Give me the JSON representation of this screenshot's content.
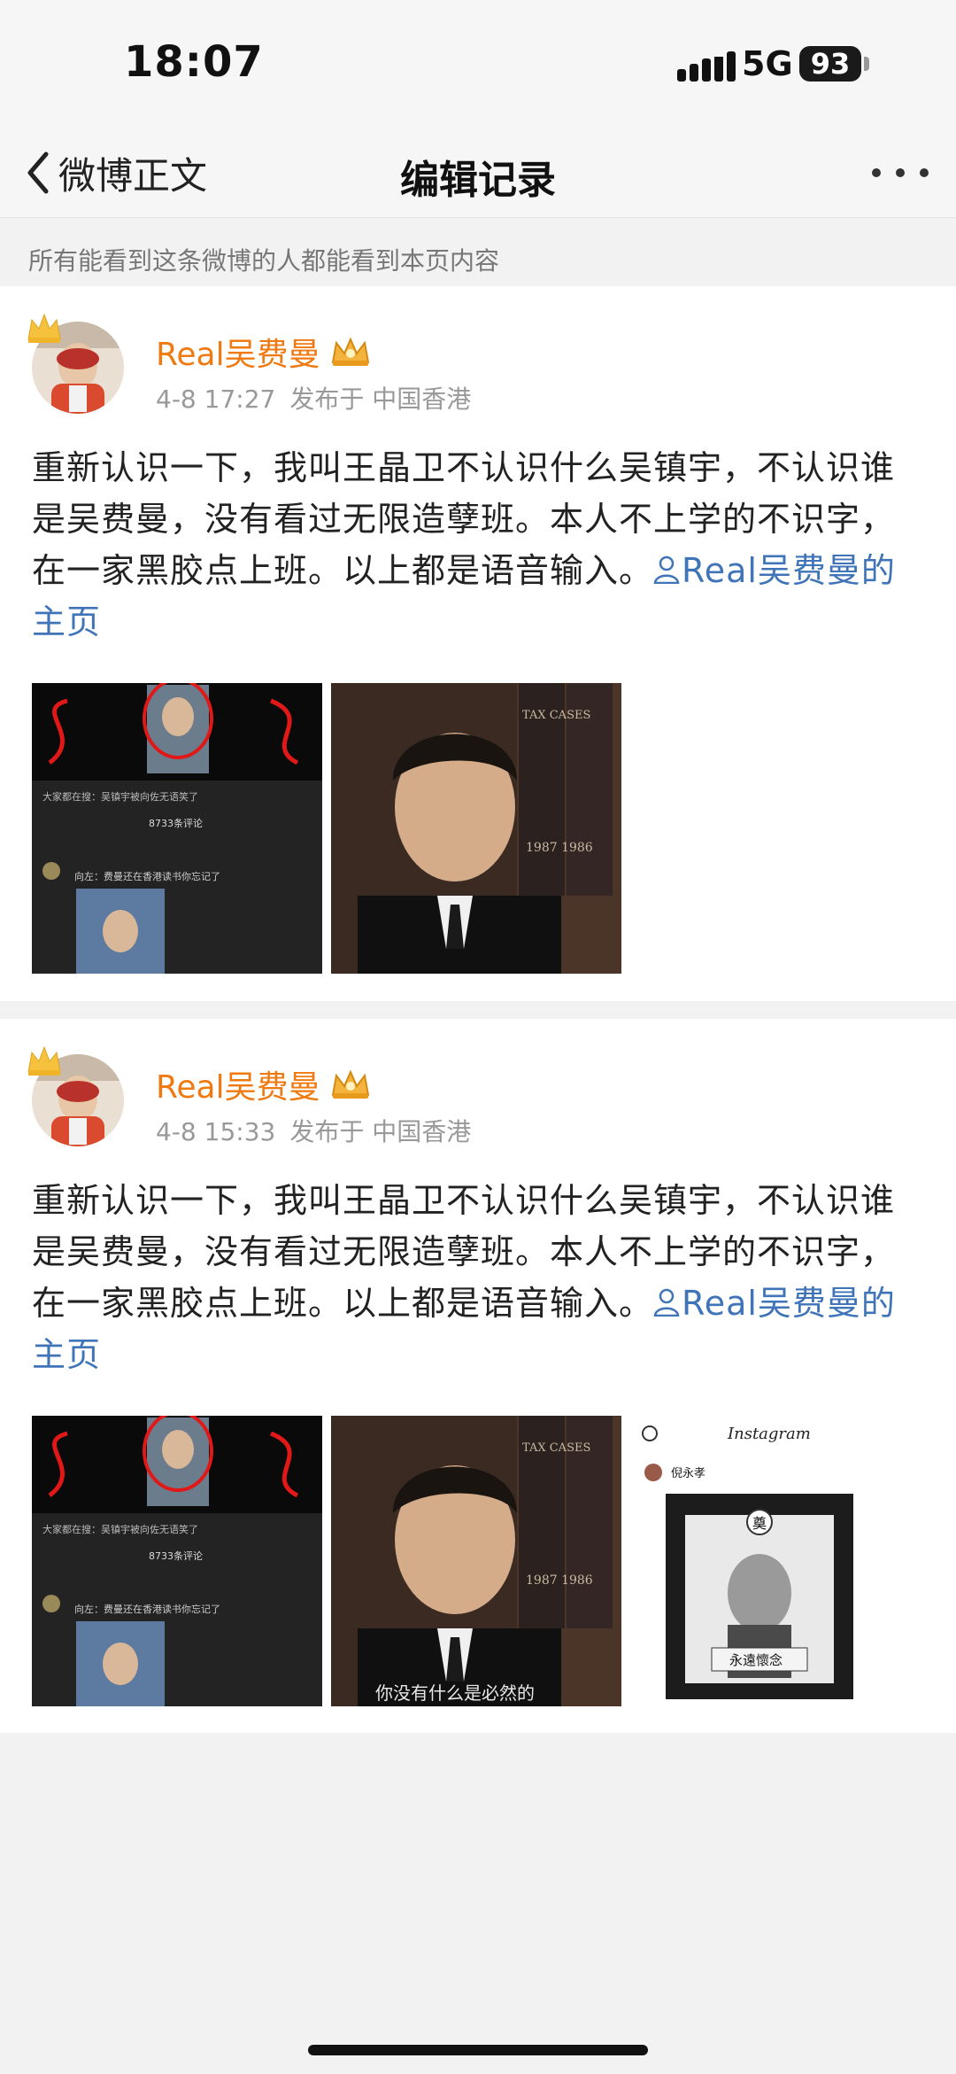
{
  "status_bar": {
    "time": "18:07",
    "network": "5G",
    "battery": "93"
  },
  "nav": {
    "back_label": "微博正文",
    "title": "编辑记录"
  },
  "notice": "所有能看到这条微博的人都能看到本页内容",
  "records": [
    {
      "username": "Real吴费曼",
      "time": "4-8 17:27",
      "location": "发布于 中国香港",
      "text": "重新认识一下，我叫王晶卫不认识什么吴镇宇，不认识谁是吴费曼，没有看过无限造孽班。本人不上学的不识字，在一家黑胶点上班。以上都是语音输入。",
      "link": "Real吴费曼的主页",
      "images": [
        {
          "banner": "大家都在搜：吴镇宇被向佐无语笑了",
          "comments": "8733条评论",
          "comment": "向左：费曼还在香港读书你忘记了",
          "icon": "video-screenshot-image"
        },
        {
          "book1": "TAX CASES",
          "book2": "TAX CASES",
          "years": "1987  1986",
          "icon": "portrait-suit-image"
        }
      ]
    },
    {
      "username": "Real吴费曼",
      "time": "4-8 15:33",
      "location": "发布于 中国香港",
      "text": "重新认识一下，我叫王晶卫不认识什么吴镇宇，不认识谁是吴费曼，没有看过无限造孽班。本人不上学的不识字，在一家黑胶点上班。以上都是语音输入。",
      "link": "Real吴费曼的主页",
      "images": [
        {
          "banner": "大家都在搜：吴镇宇被向佐无语笑了",
          "comments": "8733条评论",
          "comment": "向左：费曼还在香港读书你忘记了",
          "icon": "video-screenshot-image"
        },
        {
          "book1": "TAX CASES",
          "book2": "TAX CASES",
          "years": "1987  1986",
          "caption": "你没有什么是必然的",
          "icon": "portrait-suit-image"
        },
        {
          "app": "Instagram",
          "account": "倪永孝",
          "frame_text": "奠",
          "memorial": "永遠懷念",
          "icon": "instagram-memorial-image"
        }
      ]
    }
  ],
  "colors": {
    "username": "#f07a12",
    "link": "#3f74b8",
    "meta": "#999999",
    "background": "#f2f2f2"
  }
}
